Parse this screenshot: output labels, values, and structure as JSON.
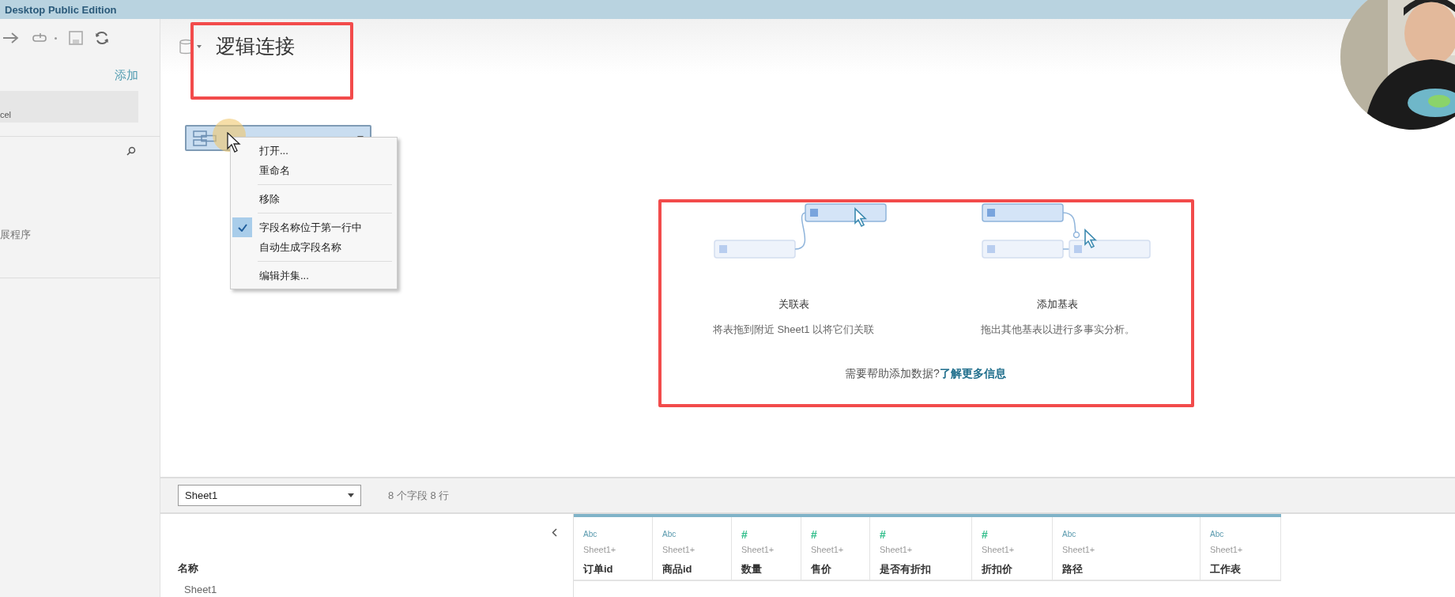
{
  "window": {
    "title": "Desktop Public Edition"
  },
  "sidebar": {
    "add_link": "添加",
    "connection": "cel",
    "extension": "展程序"
  },
  "canvas": {
    "title": "逻辑连接",
    "table_menu": [
      {
        "kind": "item",
        "label": "打开...",
        "checked": false
      },
      {
        "kind": "item",
        "label": "重命名",
        "checked": false
      },
      {
        "kind": "separator"
      },
      {
        "kind": "item",
        "label": "移除",
        "checked": false
      },
      {
        "kind": "separator"
      },
      {
        "kind": "item",
        "label": "字段名称位于第一行中",
        "checked": true
      },
      {
        "kind": "item",
        "label": "自动生成字段名称",
        "checked": false
      },
      {
        "kind": "separator"
      },
      {
        "kind": "item",
        "label": "编辑并集...",
        "checked": false
      }
    ]
  },
  "guide": {
    "cards": [
      {
        "kind": "relate",
        "title": "关联表",
        "text": "将表拖到附近 Sheet1 以将它们关联"
      },
      {
        "kind": "base",
        "title": "添加基表",
        "text": "拖出其他基表以进行多事实分析。"
      }
    ],
    "help_text": "需要帮助添加数据?",
    "help_link": "了解更多信息"
  },
  "bottom": {
    "sheet_select": "Sheet1",
    "summary": "8 个字段 8 行",
    "name_label": "名称",
    "name_value": "Sheet1"
  },
  "grid": {
    "columns": [
      {
        "kind": "string",
        "type_label": "Abc",
        "source": "Sheet1+",
        "name": "订单id"
      },
      {
        "kind": "string",
        "type_label": "Abc",
        "source": "Sheet1+",
        "name": "商品id"
      },
      {
        "kind": "number",
        "type_label": "#",
        "source": "Sheet1+",
        "name": "数量"
      },
      {
        "kind": "number",
        "type_label": "#",
        "source": "Sheet1+",
        "name": "售价"
      },
      {
        "kind": "number",
        "type_label": "#",
        "source": "Sheet1+",
        "name": "是否有折扣"
      },
      {
        "kind": "number",
        "type_label": "#",
        "source": "Sheet1+",
        "name": "折扣价"
      },
      {
        "kind": "string",
        "type_label": "Abc",
        "source": "Sheet1+",
        "name": "路径"
      },
      {
        "kind": "string",
        "type_label": "Abc",
        "source": "Sheet1+",
        "name": "工作表"
      }
    ]
  }
}
